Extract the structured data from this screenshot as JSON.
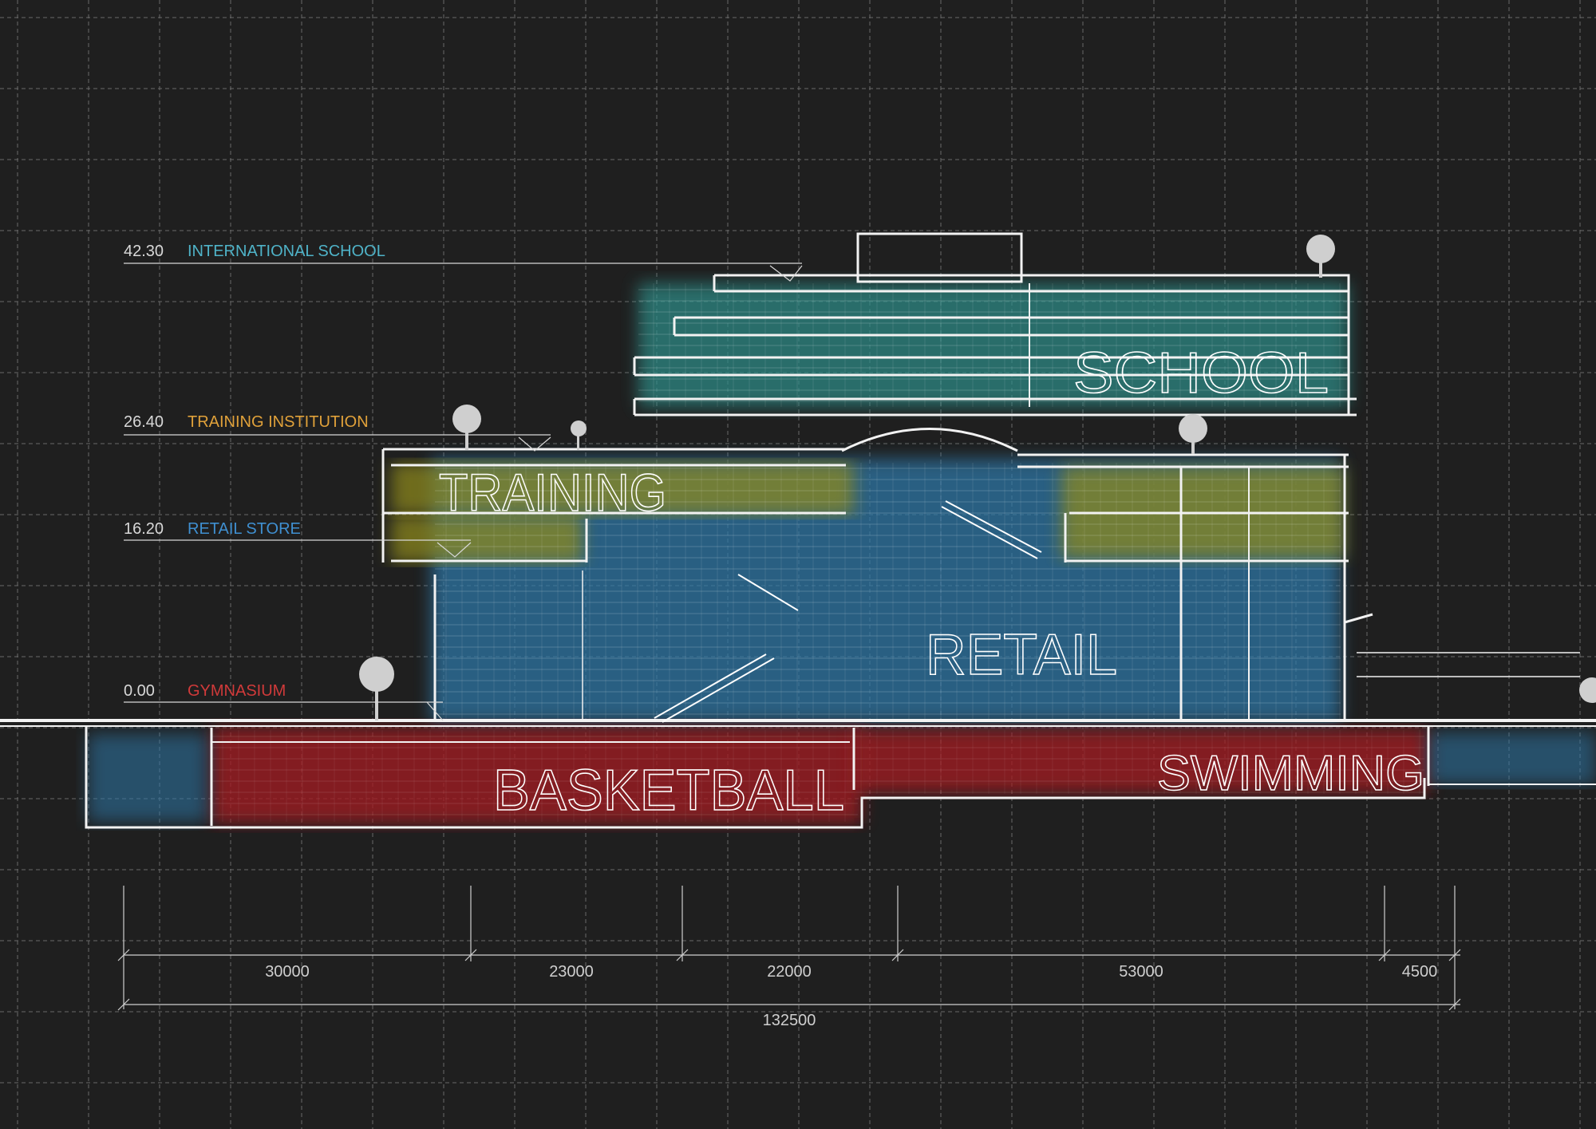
{
  "levels": [
    {
      "elevation": "42.30",
      "name": "INTERNATIONAL SCHOOL",
      "color": "#4fb3c8"
    },
    {
      "elevation": "26.40",
      "name": "TRAINING INSTITUTION",
      "color": "#e0a13a"
    },
    {
      "elevation": "16.20",
      "name": "RETAIL STORE",
      "color": "#3f8fd0"
    },
    {
      "elevation": "0.00",
      "name": "GYMNASIUM",
      "color": "#d03a3a"
    }
  ],
  "zones": {
    "school": "SCHOOL",
    "training": "TRAINING",
    "retail": "RETAIL",
    "basketball": "BASKETBALL",
    "swimming": "SWIMMING"
  },
  "zone_colors": {
    "school": "#2f8f8a",
    "training": "#8f8a1e",
    "retail": "#2f78a8",
    "gym": "#a01e22"
  },
  "dimensions": {
    "segments": [
      "30000",
      "23000",
      "22000",
      "53000",
      "4500"
    ],
    "total": "132500"
  }
}
